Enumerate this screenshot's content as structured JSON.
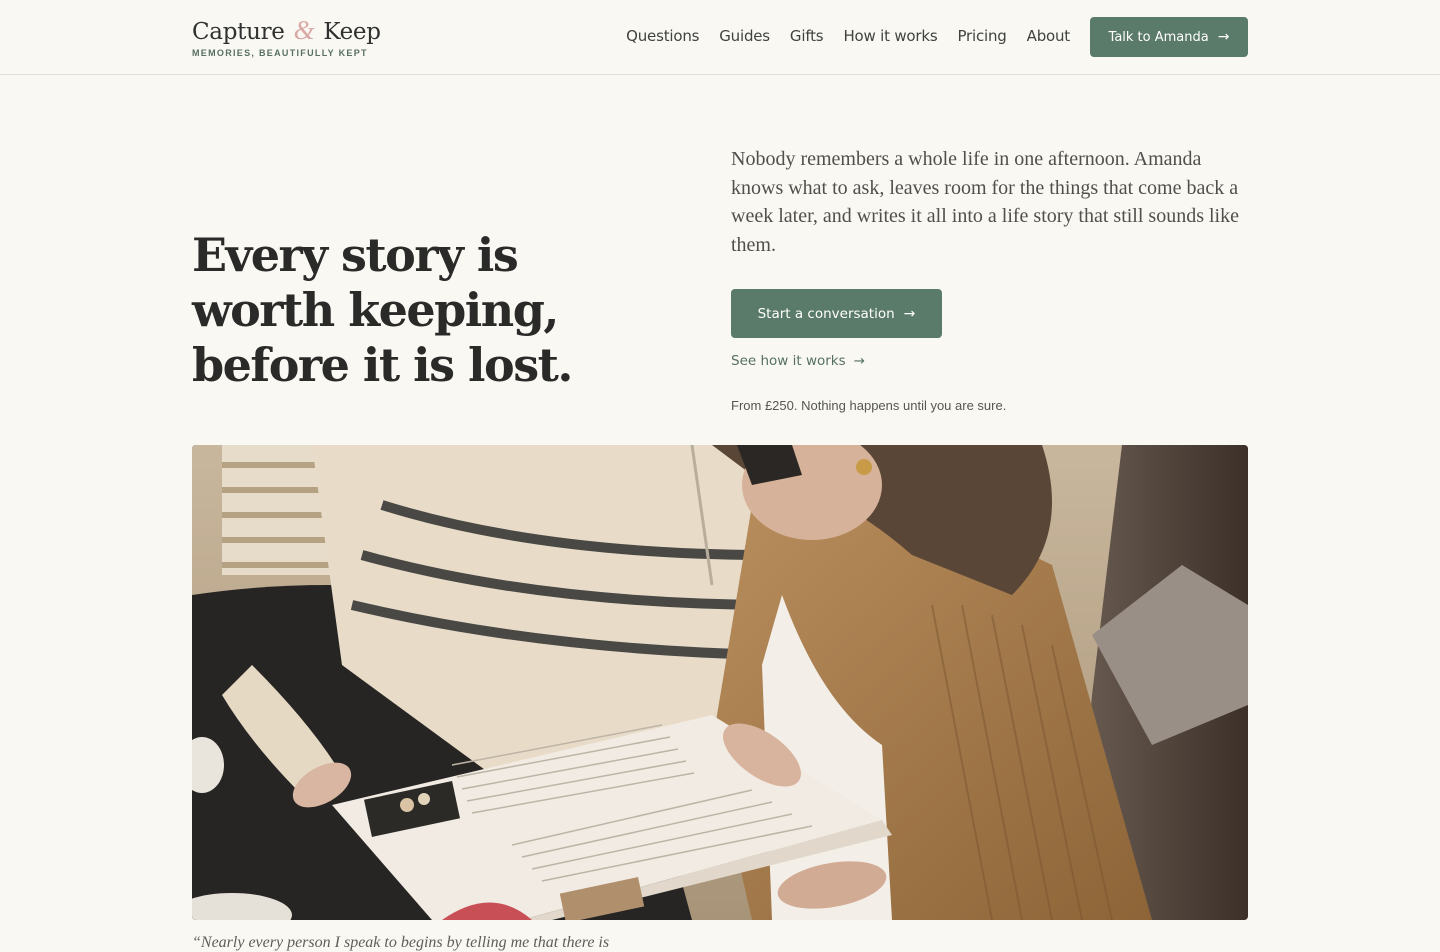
{
  "brand": {
    "name_part1": "Capture",
    "ampersand": "&",
    "name_part2": "Keep",
    "tagline": "MEMORIES, BEAUTIFULLY KEPT"
  },
  "nav": {
    "items": [
      {
        "label": "Questions"
      },
      {
        "label": "Guides"
      },
      {
        "label": "Gifts"
      },
      {
        "label": "How it works"
      },
      {
        "label": "Pricing"
      },
      {
        "label": "About"
      }
    ],
    "cta_label": "Talk to Amanda",
    "cta_arrow": "→"
  },
  "hero": {
    "title": "Every story is worth keeping, before it is lost.",
    "description": "Nobody remembers a whole life in one afternoon. Amanda knows what to ask, leaves room for the things that come back a week later, and writes it all into a life story that still sounds like them.",
    "primary_cta": "Start a conversation",
    "primary_arrow": "→",
    "secondary_link": "See how it works",
    "secondary_arrow": "→",
    "price_note": "From £250. Nothing happens until you are sure."
  },
  "quote": {
    "text": "“Nearly every person I speak to begins by telling me that there is"
  },
  "colors": {
    "accent": "#5a7a6a",
    "background": "#faf8f3",
    "ampersand": "#d8a8a4"
  }
}
